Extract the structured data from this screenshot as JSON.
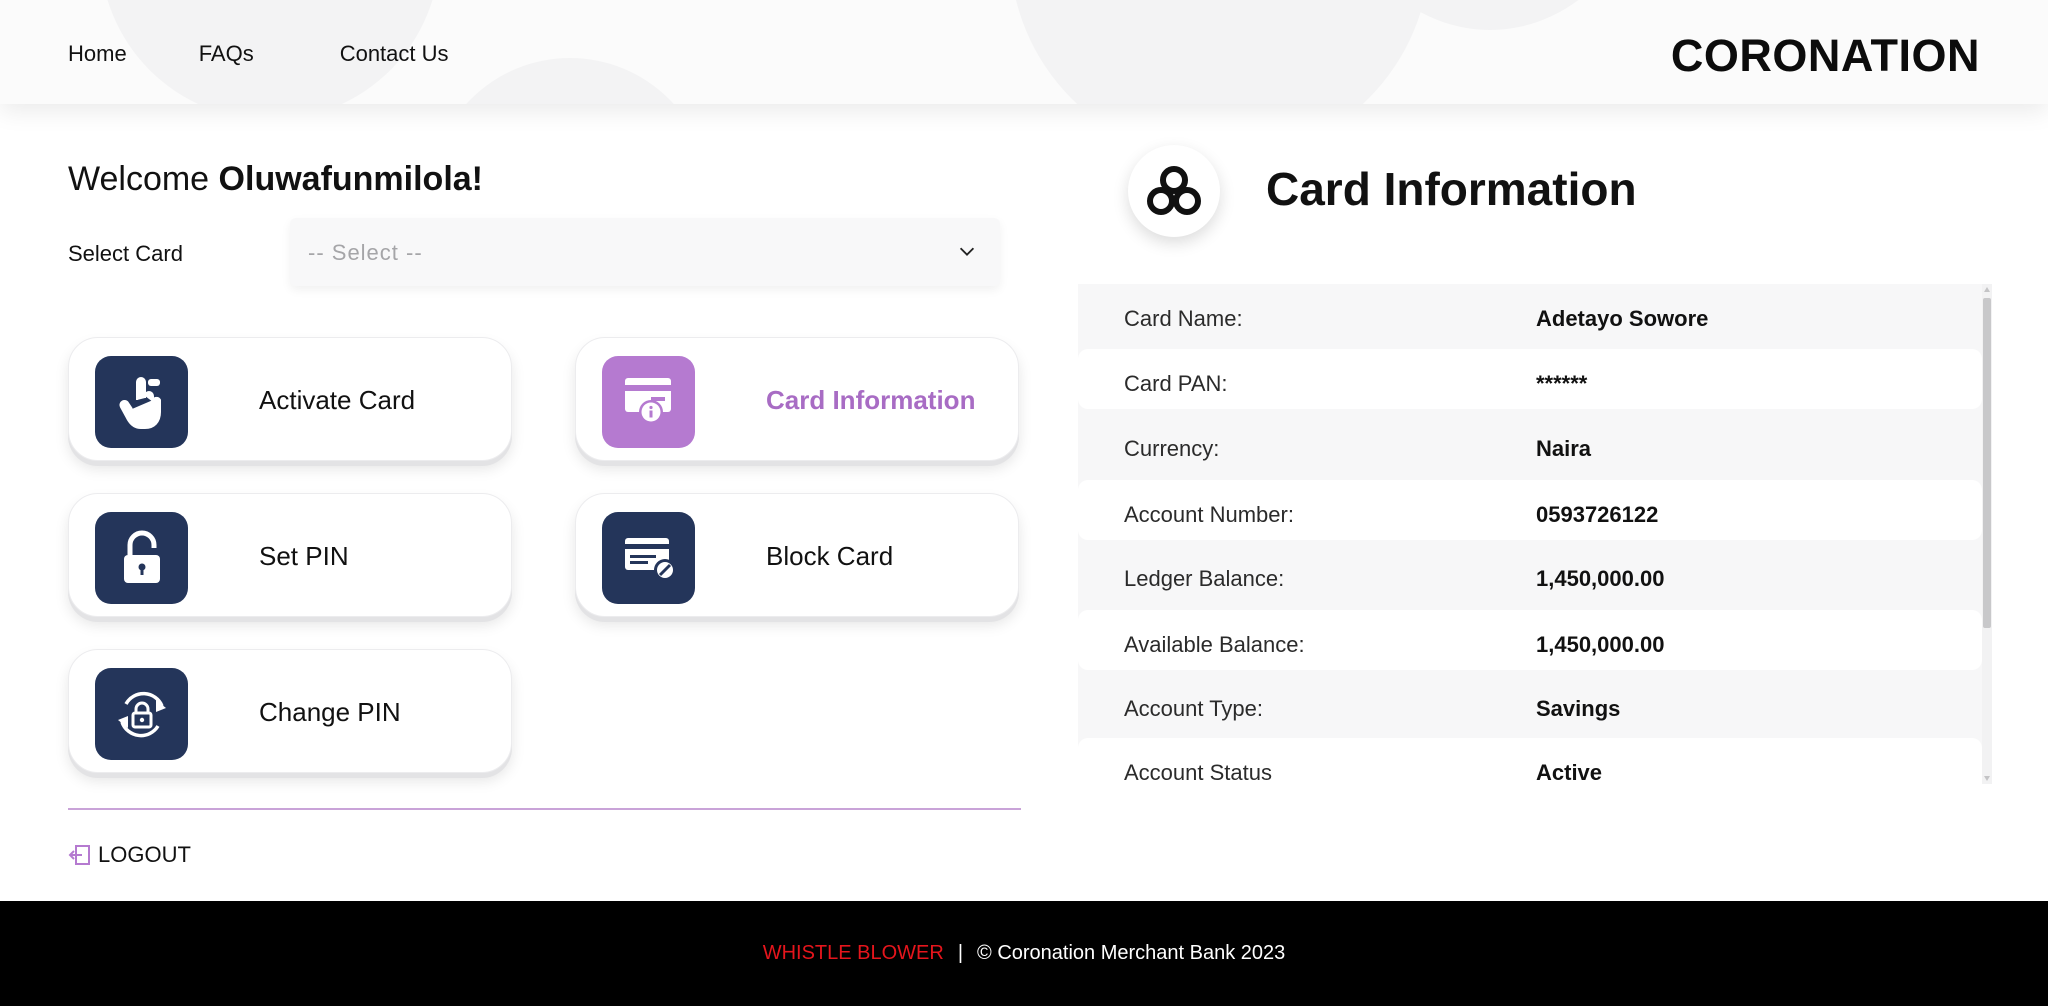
{
  "header": {
    "nav": [
      "Home",
      "FAQs",
      "Contact Us"
    ],
    "logo_text": "CORONATION"
  },
  "welcome": {
    "prefix": "Welcome",
    "name": "Oluwafunmilola!"
  },
  "card_select": {
    "label": "Select Card",
    "placeholder": "-- Select --"
  },
  "actions": [
    {
      "label": "Activate Card",
      "icon": "tap-finger-icon",
      "active": false
    },
    {
      "label": "Card Information",
      "icon": "card-info-icon",
      "active": true
    },
    {
      "label": "Set PIN",
      "icon": "padlock-icon",
      "active": false
    },
    {
      "label": "Block Card",
      "icon": "block-card-icon",
      "active": false
    },
    {
      "label": "Change PIN",
      "icon": "refresh-lock-icon",
      "active": false
    }
  ],
  "logout_label": "LOGOUT",
  "card_info": {
    "title": "Card Information",
    "rows": [
      {
        "key": "Card Name:",
        "value": "Adetayo Sowore"
      },
      {
        "key": "Card PAN:",
        "value": "******"
      },
      {
        "key": "Currency:",
        "value": "Naira"
      },
      {
        "key": "Account Number:",
        "value": "0593726122"
      },
      {
        "key": "Ledger Balance:",
        "value": "1,450,000.00"
      },
      {
        "key": "Available Balance:",
        "value": "1,450,000.00"
      },
      {
        "key": "Account Type:",
        "value": "Savings"
      },
      {
        "key": "Account Status",
        "value": "Active"
      }
    ]
  },
  "footer": {
    "whistle": "WHISTLE BLOWER",
    "separator": "|",
    "copyright": "© Coronation Merchant Bank 2023"
  },
  "colors": {
    "accent_purple": "#b57ad0",
    "navy_icon": "#24355a",
    "whistle_red": "#e5151c",
    "footer_bg": "#000000"
  }
}
